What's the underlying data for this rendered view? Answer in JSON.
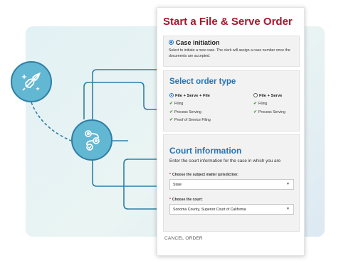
{
  "illustration": {
    "rocket_icon": "rocket-icon",
    "gears_icon": "gears-icon",
    "colors": {
      "circle_fill": "#62b7d3",
      "line": "#2f7fa4",
      "panel": "#e2f1f4"
    }
  },
  "card": {
    "title": "Start a File & Serve Order",
    "title_color": "#a8162d",
    "case_initiation": {
      "label": "Case initiation",
      "selected": true,
      "description": "Select to initiate a new case. The clerk will assign a case number once the documents are accepted."
    },
    "order_type": {
      "title": "Select order type",
      "options": [
        {
          "label": "File + Serve + File",
          "selected": true,
          "features": [
            "Filing",
            "Process Serving",
            "Proof of Service Filing"
          ]
        },
        {
          "label": "File + Serve",
          "selected": false,
          "features": [
            "Filing",
            "Process Serving"
          ]
        }
      ]
    },
    "court_info": {
      "title": "Court information",
      "description": "Enter the court information for the case in which you are",
      "jurisdiction_label": "Choose the subject matter jurisdiction:",
      "jurisdiction_value": "State",
      "court_label": "Choose the court:",
      "court_value": "Sonoma County, Superior Court of California",
      "required_mark": "*"
    },
    "cancel_label": "CANCEL ORDER"
  }
}
